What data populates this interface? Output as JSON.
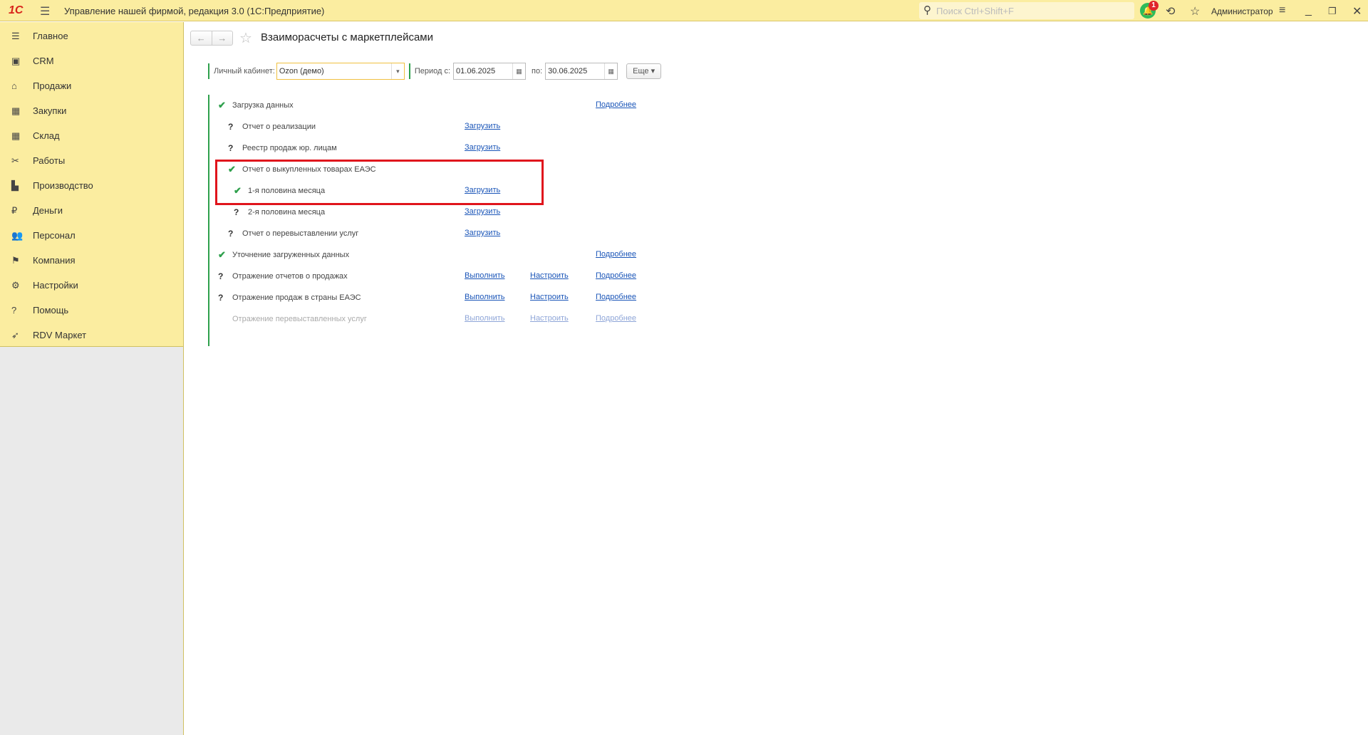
{
  "app": {
    "logo": "1С",
    "title": "Управление нашей фирмой, редакция 3.0  (1С:Предприятие)",
    "search_placeholder": "Поиск Ctrl+Shift+F",
    "notifications": "1",
    "user": "Администратор"
  },
  "sidebar": {
    "items": [
      {
        "label": "Главное",
        "icon": "menu-icon",
        "glyph": "☰"
      },
      {
        "label": "CRM",
        "icon": "crm-icon",
        "glyph": "▣"
      },
      {
        "label": "Продажи",
        "icon": "basket-icon",
        "glyph": "⌂"
      },
      {
        "label": "Закупки",
        "icon": "purchases-icon",
        "glyph": "▦"
      },
      {
        "label": "Склад",
        "icon": "warehouse-icon",
        "glyph": "▦"
      },
      {
        "label": "Работы",
        "icon": "tools-icon",
        "glyph": "✂"
      },
      {
        "label": "Производство",
        "icon": "factory-icon",
        "glyph": "▙"
      },
      {
        "label": "Деньги",
        "icon": "money-icon",
        "glyph": "₽"
      },
      {
        "label": "Персонал",
        "icon": "people-icon",
        "glyph": "👥"
      },
      {
        "label": "Компания",
        "icon": "flag-icon",
        "glyph": "⚑"
      },
      {
        "label": "Настройки",
        "icon": "gear-icon",
        "glyph": "⚙"
      },
      {
        "label": "Помощь",
        "icon": "help-icon",
        "glyph": "?"
      },
      {
        "label": "RDV Маркет",
        "icon": "rocket-icon",
        "glyph": "➶"
      }
    ]
  },
  "page": {
    "title": "Взаиморасчеты с маркетплейсами",
    "filters": {
      "account_label": "Личный кабинет:",
      "account_value": "Ozon (демо)",
      "period_label": "Период с:",
      "period_from": "01.06.2025",
      "to_label": "по:",
      "period_to": "30.06.2025",
      "more": "Еще"
    },
    "steps": [
      {
        "label": "Загрузка данных",
        "status": "done",
        "level": 0,
        "links": [
          "",
          "",
          "Подробнее"
        ]
      },
      {
        "label": "Отчет о реализации",
        "status": "pending",
        "level": 1,
        "links": [
          "Загрузить",
          "",
          ""
        ]
      },
      {
        "label": "Реестр продаж юр. лицам",
        "status": "pending",
        "level": 1,
        "links": [
          "Загрузить",
          "",
          ""
        ]
      },
      {
        "label": "Отчет о выкупленных товарах ЕАЭС",
        "status": "done",
        "level": 1,
        "links": [
          "",
          "",
          ""
        ]
      },
      {
        "label": "1-я половина месяца",
        "status": "done",
        "level": 2,
        "links": [
          "Загрузить",
          "",
          ""
        ]
      },
      {
        "label": "2-я половина месяца",
        "status": "pending",
        "level": 2,
        "links": [
          "Загрузить",
          "",
          ""
        ]
      },
      {
        "label": "Отчет о перевыставлении услуг",
        "status": "pending",
        "level": 1,
        "links": [
          "Загрузить",
          "",
          ""
        ]
      },
      {
        "label": "Уточнение загруженных данных",
        "status": "done",
        "level": 0,
        "links": [
          "",
          "",
          "Подробнее"
        ]
      },
      {
        "label": "Отражение отчетов о продажах",
        "status": "pending",
        "level": 0,
        "links": [
          "Выполнить",
          "Настроить",
          "Подробнее"
        ]
      },
      {
        "label": "Отражение продаж в страны ЕАЭС",
        "status": "pending",
        "level": 0,
        "links": [
          "Выполнить",
          "Настроить",
          "Подробнее"
        ]
      },
      {
        "label": "Отражение перевыставленных услуг",
        "status": "disabled",
        "level": 0,
        "links": [
          "Выполнить",
          "Настроить",
          "Подробнее"
        ]
      }
    ]
  }
}
